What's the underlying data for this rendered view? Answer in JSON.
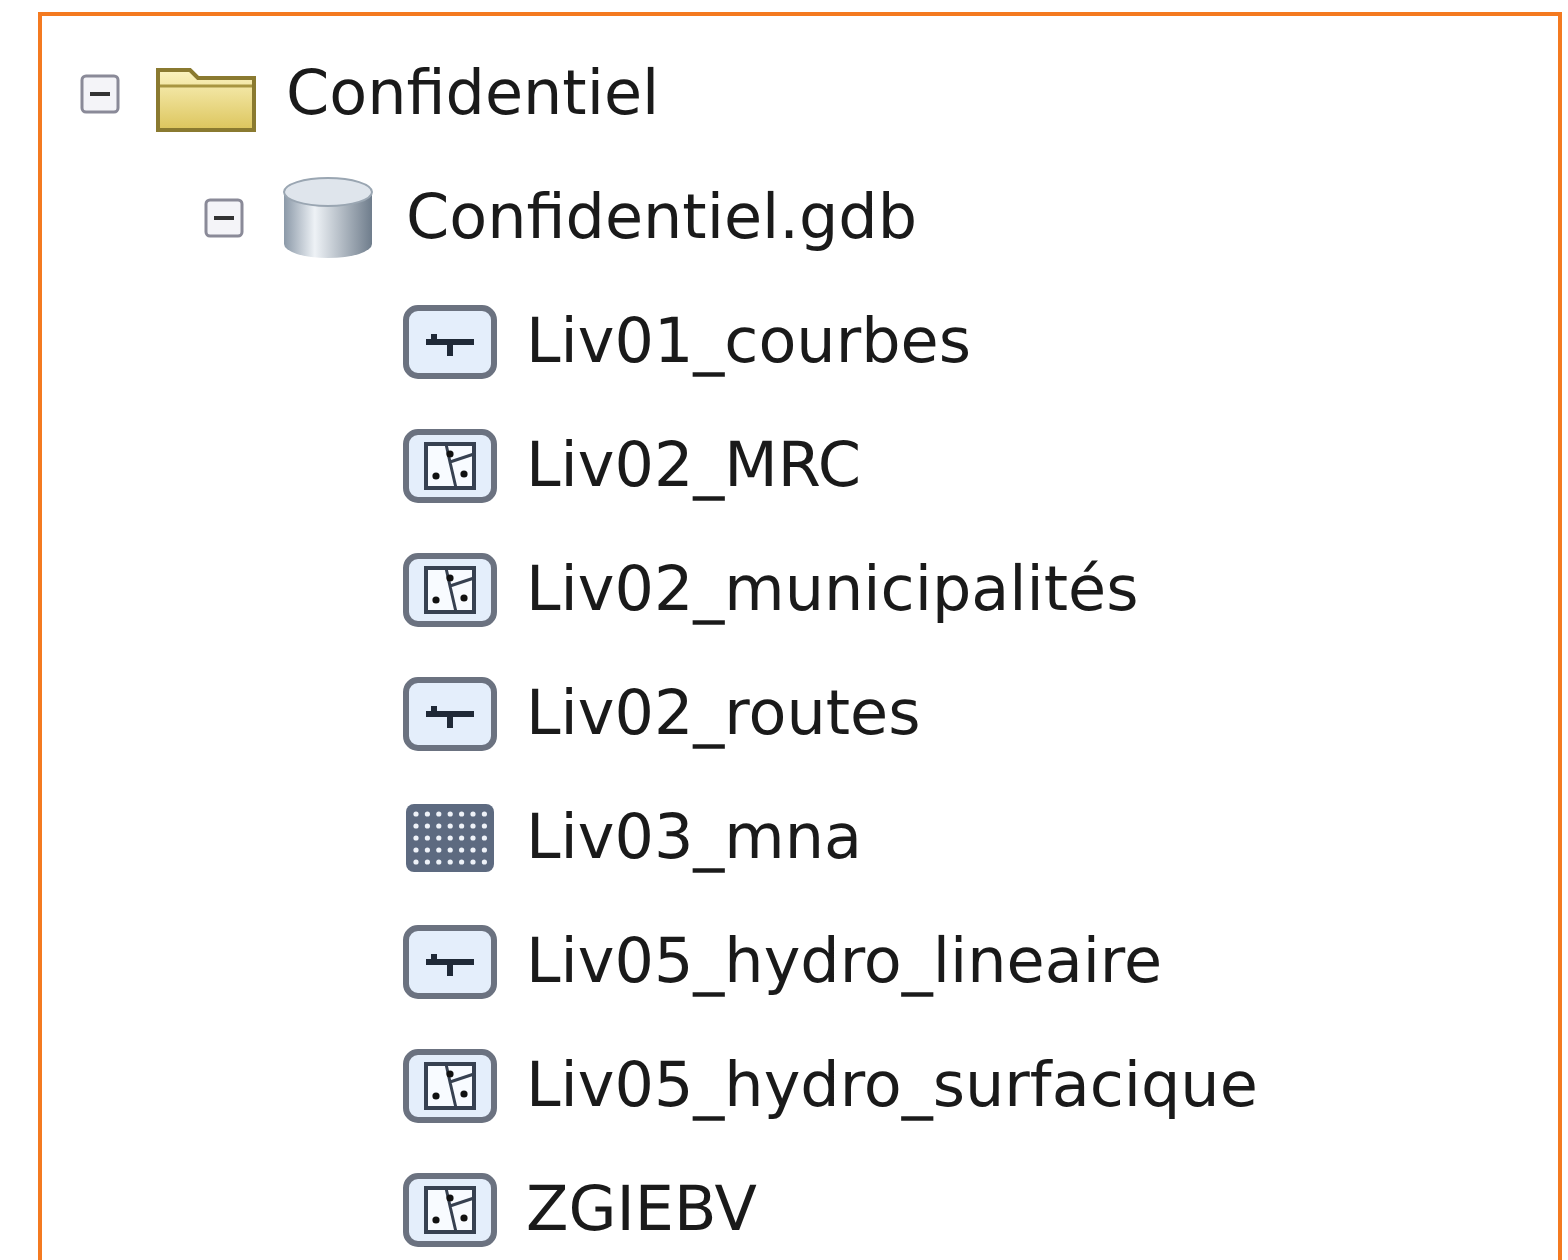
{
  "tree": [
    {
      "label": "Confidentiel",
      "kind": "folder",
      "expanded": true,
      "children": [
        {
          "label": "Confidentiel.gdb",
          "kind": "geodatabase",
          "expanded": true,
          "children": [
            {
              "label": "Liv01_courbes",
              "kind": "line"
            },
            {
              "label": "Liv02_MRC",
              "kind": "polygon"
            },
            {
              "label": "Liv02_municipalités",
              "kind": "polygon"
            },
            {
              "label": "Liv02_routes",
              "kind": "line"
            },
            {
              "label": "Liv03_mna",
              "kind": "raster"
            },
            {
              "label": "Liv05_hydro_lineaire",
              "kind": "line"
            },
            {
              "label": "Liv05_hydro_surfacique",
              "kind": "polygon"
            },
            {
              "label": "ZGIEBV",
              "kind": "polygon"
            }
          ]
        }
      ]
    }
  ]
}
